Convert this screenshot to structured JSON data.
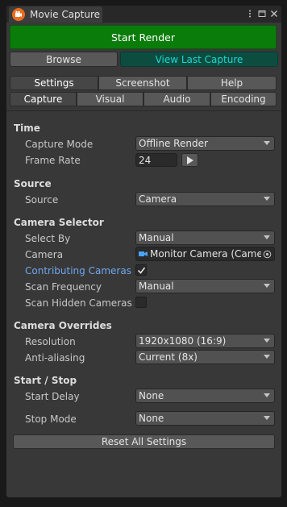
{
  "window": {
    "title": "Movie Capture",
    "icon": "movie-capture-icon",
    "controls": [
      "more-options-icon",
      "maximize-icon",
      "close-icon"
    ]
  },
  "actions": {
    "start_render": "Start Render",
    "browse": "Browse",
    "view_last_capture": "View Last Capture"
  },
  "main_tabs": [
    "Settings",
    "Screenshot",
    "Help"
  ],
  "main_tabs_selected": "Settings",
  "sub_tabs": [
    "Capture",
    "Visual",
    "Audio",
    "Encoding"
  ],
  "sub_tabs_selected": "Capture",
  "time": {
    "header": "Time",
    "capture_mode_label": "Capture Mode",
    "capture_mode_value": "Offline Render",
    "frame_rate_label": "Frame Rate",
    "frame_rate_value": "24"
  },
  "source": {
    "header": "Source",
    "source_label": "Source",
    "source_value": "Camera"
  },
  "camera_selector": {
    "header": "Camera Selector",
    "select_by_label": "Select By",
    "select_by_value": "Manual",
    "camera_label": "Camera",
    "camera_value": "Monitor Camera (Camera)",
    "contributing_label": "Contributing Cameras",
    "contributing_checked": true,
    "scan_frequency_label": "Scan Frequency",
    "scan_frequency_value": "Manual",
    "scan_hidden_label": "Scan Hidden Cameras",
    "scan_hidden_checked": false
  },
  "camera_overrides": {
    "header": "Camera Overrides",
    "resolution_label": "Resolution",
    "resolution_value": "1920x1080 (16:9)",
    "anti_aliasing_label": "Anti-aliasing",
    "anti_aliasing_value": "Current (8x)"
  },
  "start_stop": {
    "header": "Start / Stop",
    "start_delay_label": "Start Delay",
    "start_delay_value": "None",
    "stop_mode_label": "Stop Mode",
    "stop_mode_value": "None"
  },
  "reset_all": "Reset All Settings",
  "colors": {
    "start_render_bg": "#0a7c0a",
    "view_last_bg": "#0d4d3f",
    "view_last_text": "#1fd6d6",
    "highlight_label": "#6fa7ee",
    "tab_icon": "#e86d1f"
  }
}
